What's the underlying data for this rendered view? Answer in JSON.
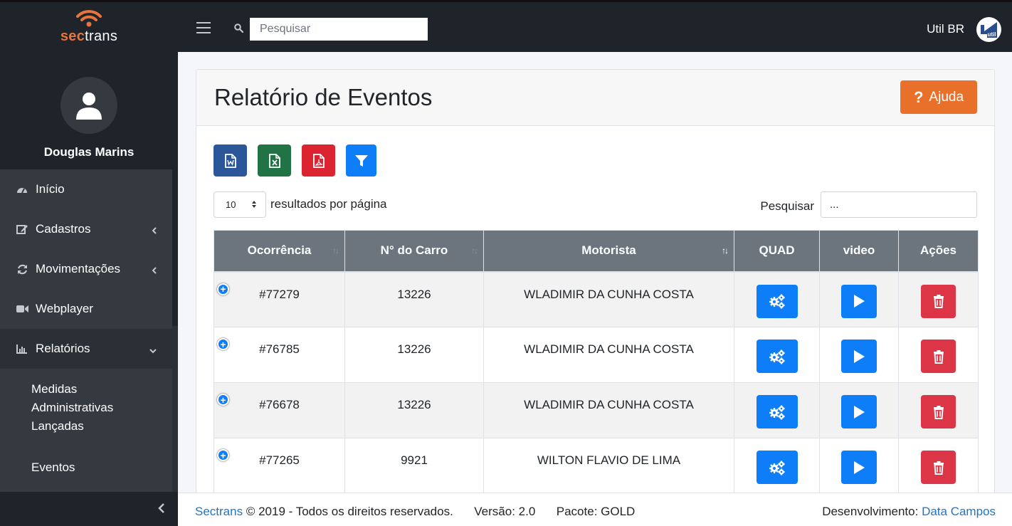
{
  "brand": {
    "part1": "sec",
    "part2": "trans"
  },
  "topbar": {
    "search_placeholder": "Pesquisar",
    "user_label": "Util BR",
    "avatar_text": "util"
  },
  "sidebar": {
    "user_name": "Douglas Marins",
    "items": [
      {
        "label": "Início",
        "icon": "dashboard-icon"
      },
      {
        "label": "Cadastros",
        "icon": "edit-icon"
      },
      {
        "label": "Movimentações",
        "icon": "sync-icon"
      },
      {
        "label": "Webplayer",
        "icon": "video-camera-icon"
      },
      {
        "label": "Relatórios",
        "icon": "bar-chart-icon"
      }
    ],
    "sub_items": [
      {
        "label": "Medidas Administrativas Lançadas"
      },
      {
        "label": "Eventos"
      }
    ]
  },
  "page": {
    "title": "Relatório de Eventos",
    "help_label": "Ajuda"
  },
  "table_controls": {
    "page_length": "10",
    "length_label": "resultados por página",
    "filter_label": "Pesquisar",
    "filter_value": "..."
  },
  "table": {
    "columns": [
      "Ocorrência",
      "N° do Carro",
      "Motorista",
      "QUAD",
      "video",
      "Ações"
    ],
    "rows": [
      {
        "ocorrencia": "#77279",
        "carro": "13226",
        "motorista": "WLADIMIR DA CUNHA COSTA"
      },
      {
        "ocorrencia": "#76785",
        "carro": "13226",
        "motorista": "WLADIMIR DA CUNHA COSTA"
      },
      {
        "ocorrencia": "#76678",
        "carro": "13226",
        "motorista": "WLADIMIR DA CUNHA COSTA"
      },
      {
        "ocorrencia": "#77265",
        "carro": "9921",
        "motorista": "WILTON FLAVIO DE LIMA"
      }
    ]
  },
  "footer": {
    "company_link": "Sectrans",
    "copyright": "© 2019 - Todos os direitos reservados.",
    "version": "Versão: 2.0",
    "package": "Pacote: GOLD",
    "dev_label": "Desenvolvimento:",
    "dev_link": "Data Campos"
  },
  "colors": {
    "accent": "#e8702a",
    "primary": "#0d7ef7",
    "danger": "#dc3545",
    "sidebar": "#343a40",
    "topbar": "#1f242b"
  }
}
